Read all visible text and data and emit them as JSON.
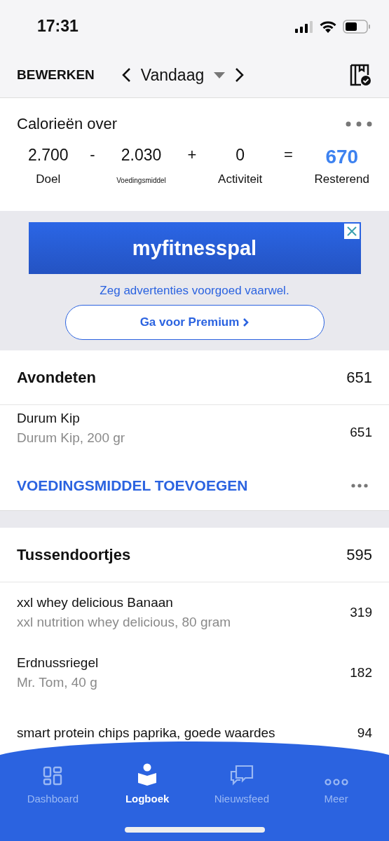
{
  "status_bar": {
    "time": "17:31"
  },
  "nav": {
    "edit": "BEWERKEN",
    "date": "Vandaag"
  },
  "summary": {
    "title": "Calorieën over",
    "terms": [
      {
        "value": "2.700",
        "label": "Doel",
        "kind": "normal"
      },
      {
        "value": "-",
        "kind": "operator"
      },
      {
        "value": "2.030",
        "label": "Voedingsmiddel",
        "kind": "small"
      },
      {
        "value": "+",
        "kind": "operator"
      },
      {
        "value": "0",
        "label": "Activiteit",
        "kind": "normal"
      },
      {
        "value": "=",
        "kind": "operator"
      },
      {
        "value": "670",
        "label": "Resterend",
        "kind": "result"
      }
    ]
  },
  "ad": {
    "logo": "myfitnesspal",
    "tagline": "Zeg advertenties voorgoed vaarwel.",
    "button": "Ga voor Premium"
  },
  "meals": [
    {
      "name": "Avondeten",
      "total": "651",
      "add": "VOEDINGSMIDDEL TOEVOEGEN",
      "items": [
        {
          "name": "Durum Kip",
          "detail": "Durum Kip, 200 gr",
          "calories": "651"
        }
      ]
    },
    {
      "name": "Tussendoortjes",
      "total": "595",
      "items": [
        {
          "name": "xxl whey delicious Banaan",
          "detail": "xxl nutrition whey delicious, 80 gram",
          "calories": "319"
        },
        {
          "name": "Erdnussriegel",
          "detail": "Mr. Tom, 40 g",
          "calories": "182"
        },
        {
          "name": "smart protein chips paprika, goede waardes",
          "calories": "94"
        }
      ]
    }
  ],
  "tabs": [
    {
      "label": "Dashboard",
      "selected": false
    },
    {
      "label": "Logboek",
      "selected": true
    },
    {
      "label": "Nieuwsfeed",
      "selected": false
    },
    {
      "label": "Meer",
      "selected": false
    }
  ]
}
